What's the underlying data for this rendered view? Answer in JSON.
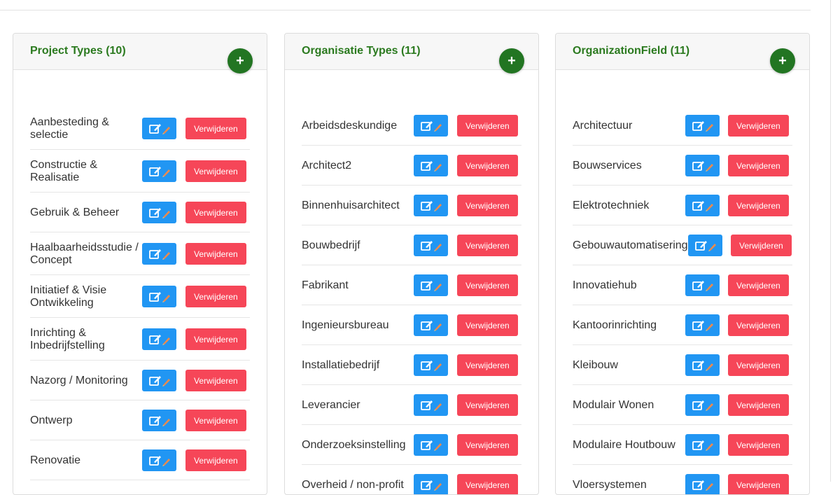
{
  "panels": [
    {
      "title": "Project Types (10)",
      "add_label": "+",
      "items": [
        {
          "label_lines": [
            "Aanbesteding &",
            "selectie"
          ],
          "edit_icon": "edit-pencil-icon",
          "delete_label": "Verwijderen"
        },
        {
          "label_lines": [
            "Constructie &",
            "Realisatie"
          ],
          "edit_icon": "edit-pencil-icon",
          "delete_label": "Verwijderen"
        },
        {
          "label_lines": [
            "Gebruik & Beheer"
          ],
          "edit_icon": "edit-pencil-icon",
          "delete_label": "Verwijderen"
        },
        {
          "label_lines": [
            "Haalbaarheidsstudie /",
            "Concept"
          ],
          "edit_icon": "edit-pencil-icon",
          "delete_label": "Verwijderen"
        },
        {
          "label_lines": [
            "Initiatief & Visie",
            "Ontwikkeling"
          ],
          "edit_icon": "edit-pencil-icon",
          "delete_label": "Verwijderen"
        },
        {
          "label_lines": [
            "Inrichting &",
            "Inbedrijfstelling"
          ],
          "edit_icon": "edit-pencil-icon",
          "delete_label": "Verwijderen"
        },
        {
          "label_lines": [
            "Nazorg / Monitoring"
          ],
          "edit_icon": "edit-pencil-icon",
          "delete_label": "Verwijderen"
        },
        {
          "label_lines": [
            "Ontwerp"
          ],
          "edit_icon": "edit-pencil-icon",
          "delete_label": "Verwijderen"
        },
        {
          "label_lines": [
            "Renovatie"
          ],
          "edit_icon": "edit-pencil-icon",
          "delete_label": "Verwijderen"
        }
      ]
    },
    {
      "title": "Organisatie Types (11)",
      "add_label": "+",
      "items": [
        {
          "label_lines": [
            "Arbeidsdeskundige"
          ],
          "edit_icon": "edit-pencil-icon",
          "delete_label": "Verwijderen"
        },
        {
          "label_lines": [
            "Architect2"
          ],
          "edit_icon": "edit-pencil-icon",
          "delete_label": "Verwijderen"
        },
        {
          "label_lines": [
            "Binnenhuisarchitect"
          ],
          "edit_icon": "edit-pencil-icon",
          "delete_label": "Verwijderen"
        },
        {
          "label_lines": [
            "Bouwbedrijf"
          ],
          "edit_icon": "edit-pencil-icon",
          "delete_label": "Verwijderen"
        },
        {
          "label_lines": [
            "Fabrikant"
          ],
          "edit_icon": "edit-pencil-icon",
          "delete_label": "Verwijderen"
        },
        {
          "label_lines": [
            "Ingenieursbureau"
          ],
          "edit_icon": "edit-pencil-icon",
          "delete_label": "Verwijderen"
        },
        {
          "label_lines": [
            "Installatiebedrijf"
          ],
          "edit_icon": "edit-pencil-icon",
          "delete_label": "Verwijderen"
        },
        {
          "label_lines": [
            "Leverancier"
          ],
          "edit_icon": "edit-pencil-icon",
          "delete_label": "Verwijderen"
        },
        {
          "label_lines": [
            "Onderzoeksinstelling"
          ],
          "edit_icon": "edit-pencil-icon",
          "delete_label": "Verwijderen"
        },
        {
          "label_lines": [
            "Overheid / non-profit"
          ],
          "edit_icon": "edit-pencil-icon",
          "delete_label": "Verwijderen"
        }
      ]
    },
    {
      "title": "OrganizationField (11)",
      "add_label": "+",
      "items": [
        {
          "label_lines": [
            "Architectuur"
          ],
          "edit_icon": "edit-pencil-icon",
          "delete_label": "Verwijderen"
        },
        {
          "label_lines": [
            "Bouwservices"
          ],
          "edit_icon": "edit-pencil-icon",
          "delete_label": "Verwijderen"
        },
        {
          "label_lines": [
            "Elektrotechniek"
          ],
          "edit_icon": "edit-pencil-icon",
          "delete_label": "Verwijderen"
        },
        {
          "label_lines": [
            "Gebouwautomatisering"
          ],
          "edit_icon": "edit-pencil-icon",
          "delete_label": "Verwijderen"
        },
        {
          "label_lines": [
            "Innovatiehub"
          ],
          "edit_icon": "edit-pencil-icon",
          "delete_label": "Verwijderen"
        },
        {
          "label_lines": [
            "Kantoorinrichting"
          ],
          "edit_icon": "edit-pencil-icon",
          "delete_label": "Verwijderen"
        },
        {
          "label_lines": [
            "Kleibouw"
          ],
          "edit_icon": "edit-pencil-icon",
          "delete_label": "Verwijderen"
        },
        {
          "label_lines": [
            "Modulair Wonen"
          ],
          "edit_icon": "edit-pencil-icon",
          "delete_label": "Verwijderen"
        },
        {
          "label_lines": [
            "Modulaire Houtbouw"
          ],
          "edit_icon": "edit-pencil-icon",
          "delete_label": "Verwijderen"
        },
        {
          "label_lines": [
            "Vloersystemen"
          ],
          "edit_icon": "edit-pencil-icon",
          "delete_label": "Verwijderen"
        }
      ]
    }
  ],
  "colors": {
    "title_green": "#2b7a1f",
    "add_button": "#227522",
    "edit_button": "#2196f3",
    "delete_button": "#f64658"
  }
}
